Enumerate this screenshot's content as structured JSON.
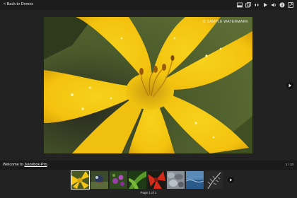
{
  "nav": {
    "back_label": "< Back to Demos"
  },
  "toolbar": {
    "buttons": [
      {
        "icon": "thumbnails-icon"
      },
      {
        "icon": "open-image-icon"
      },
      {
        "icon": "expand-icon"
      },
      {
        "icon": "play-icon"
      },
      {
        "icon": "audio-icon"
      },
      {
        "icon": "info-icon"
      },
      {
        "icon": "fullscreen-icon"
      }
    ]
  },
  "image": {
    "watermark": "© SAMPLE WATERMARK"
  },
  "caption": {
    "prefix": "Welcome to ",
    "link": "Juicebox-Pro",
    "suffix": "."
  },
  "counter": "1 / 10",
  "thumbnails": [
    {
      "name": "yellow-lily",
      "selected": true
    },
    {
      "name": "bird"
    },
    {
      "name": "purple-flowers"
    },
    {
      "name": "green-leaves"
    },
    {
      "name": "red-flower"
    },
    {
      "name": "pebbles"
    },
    {
      "name": "blue-water"
    },
    {
      "name": "fern"
    }
  ],
  "pagination": "Page 1 of 2",
  "colors": {
    "background": "#222222",
    "bar": "#1a1a1a",
    "accent": "#ffffff"
  }
}
